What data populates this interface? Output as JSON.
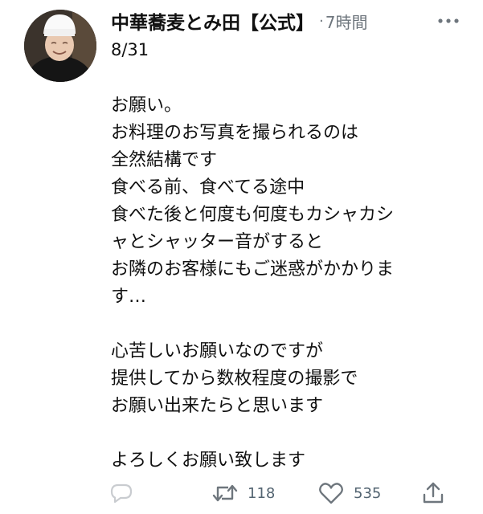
{
  "tweet": {
    "display_name": "中華蕎麦とみ田【公式】",
    "separator": "·",
    "timestamp": "7時間",
    "date": "8/31",
    "paragraphs": [
      [
        "お願い。",
        "お料理のお写真を撮られるのは",
        "全然結構です",
        "食べる前、食べてる途中",
        "食べた後と何度も何度もカシャカシ",
        "ャとシャッター音がすると",
        "お隣のお客様にもご迷惑がかかりま",
        "す…"
      ],
      [
        "心苦しいお願いなのですが",
        "提供してから数枚程度の撮影で",
        "お願い出来たらと思います"
      ],
      [
        "よろしくお願い致します"
      ]
    ]
  },
  "actions": {
    "reply": {
      "icon": "reply-icon",
      "count": ""
    },
    "retweet": {
      "icon": "retweet-icon",
      "count": "118"
    },
    "like": {
      "icon": "heart-icon",
      "count": "535"
    },
    "share": {
      "icon": "share-icon"
    }
  },
  "colors": {
    "text": "#111111",
    "muted": "#6e767d",
    "background": "#ffffff"
  }
}
